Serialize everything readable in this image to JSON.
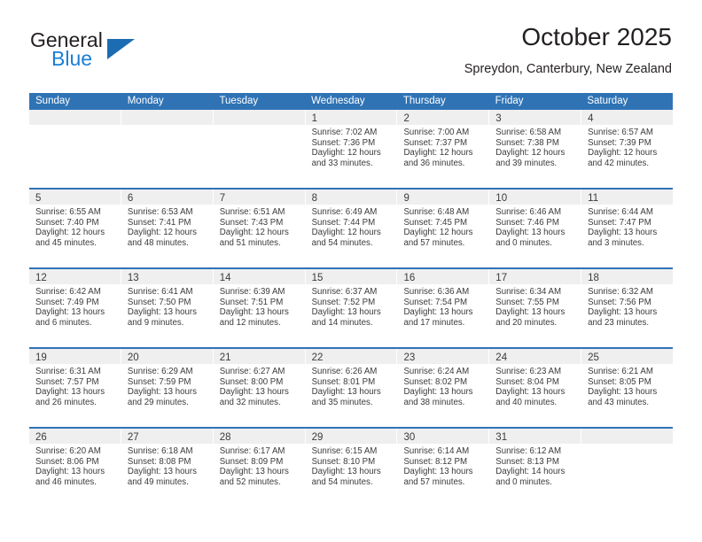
{
  "brand": {
    "name_part1": "General",
    "name_part2": "Blue"
  },
  "header": {
    "title": "October 2025",
    "location": "Spreydon, Canterbury, New Zealand"
  },
  "colors": {
    "header_blue": "#2f73b5",
    "brand_blue": "#1a7fd4",
    "day_band_gray": "#efeff0"
  },
  "weekdays": [
    "Sunday",
    "Monday",
    "Tuesday",
    "Wednesday",
    "Thursday",
    "Friday",
    "Saturday"
  ],
  "weeks": [
    [
      {
        "day": "",
        "sunrise": "",
        "sunset": "",
        "daylight1": "",
        "daylight2": ""
      },
      {
        "day": "",
        "sunrise": "",
        "sunset": "",
        "daylight1": "",
        "daylight2": ""
      },
      {
        "day": "",
        "sunrise": "",
        "sunset": "",
        "daylight1": "",
        "daylight2": ""
      },
      {
        "day": "1",
        "sunrise": "Sunrise: 7:02 AM",
        "sunset": "Sunset: 7:36 PM",
        "daylight1": "Daylight: 12 hours",
        "daylight2": "and 33 minutes."
      },
      {
        "day": "2",
        "sunrise": "Sunrise: 7:00 AM",
        "sunset": "Sunset: 7:37 PM",
        "daylight1": "Daylight: 12 hours",
        "daylight2": "and 36 minutes."
      },
      {
        "day": "3",
        "sunrise": "Sunrise: 6:58 AM",
        "sunset": "Sunset: 7:38 PM",
        "daylight1": "Daylight: 12 hours",
        "daylight2": "and 39 minutes."
      },
      {
        "day": "4",
        "sunrise": "Sunrise: 6:57 AM",
        "sunset": "Sunset: 7:39 PM",
        "daylight1": "Daylight: 12 hours",
        "daylight2": "and 42 minutes."
      }
    ],
    [
      {
        "day": "5",
        "sunrise": "Sunrise: 6:55 AM",
        "sunset": "Sunset: 7:40 PM",
        "daylight1": "Daylight: 12 hours",
        "daylight2": "and 45 minutes."
      },
      {
        "day": "6",
        "sunrise": "Sunrise: 6:53 AM",
        "sunset": "Sunset: 7:41 PM",
        "daylight1": "Daylight: 12 hours",
        "daylight2": "and 48 minutes."
      },
      {
        "day": "7",
        "sunrise": "Sunrise: 6:51 AM",
        "sunset": "Sunset: 7:43 PM",
        "daylight1": "Daylight: 12 hours",
        "daylight2": "and 51 minutes."
      },
      {
        "day": "8",
        "sunrise": "Sunrise: 6:49 AM",
        "sunset": "Sunset: 7:44 PM",
        "daylight1": "Daylight: 12 hours",
        "daylight2": "and 54 minutes."
      },
      {
        "day": "9",
        "sunrise": "Sunrise: 6:48 AM",
        "sunset": "Sunset: 7:45 PM",
        "daylight1": "Daylight: 12 hours",
        "daylight2": "and 57 minutes."
      },
      {
        "day": "10",
        "sunrise": "Sunrise: 6:46 AM",
        "sunset": "Sunset: 7:46 PM",
        "daylight1": "Daylight: 13 hours",
        "daylight2": "and 0 minutes."
      },
      {
        "day": "11",
        "sunrise": "Sunrise: 6:44 AM",
        "sunset": "Sunset: 7:47 PM",
        "daylight1": "Daylight: 13 hours",
        "daylight2": "and 3 minutes."
      }
    ],
    [
      {
        "day": "12",
        "sunrise": "Sunrise: 6:42 AM",
        "sunset": "Sunset: 7:49 PM",
        "daylight1": "Daylight: 13 hours",
        "daylight2": "and 6 minutes."
      },
      {
        "day": "13",
        "sunrise": "Sunrise: 6:41 AM",
        "sunset": "Sunset: 7:50 PM",
        "daylight1": "Daylight: 13 hours",
        "daylight2": "and 9 minutes."
      },
      {
        "day": "14",
        "sunrise": "Sunrise: 6:39 AM",
        "sunset": "Sunset: 7:51 PM",
        "daylight1": "Daylight: 13 hours",
        "daylight2": "and 12 minutes."
      },
      {
        "day": "15",
        "sunrise": "Sunrise: 6:37 AM",
        "sunset": "Sunset: 7:52 PM",
        "daylight1": "Daylight: 13 hours",
        "daylight2": "and 14 minutes."
      },
      {
        "day": "16",
        "sunrise": "Sunrise: 6:36 AM",
        "sunset": "Sunset: 7:54 PM",
        "daylight1": "Daylight: 13 hours",
        "daylight2": "and 17 minutes."
      },
      {
        "day": "17",
        "sunrise": "Sunrise: 6:34 AM",
        "sunset": "Sunset: 7:55 PM",
        "daylight1": "Daylight: 13 hours",
        "daylight2": "and 20 minutes."
      },
      {
        "day": "18",
        "sunrise": "Sunrise: 6:32 AM",
        "sunset": "Sunset: 7:56 PM",
        "daylight1": "Daylight: 13 hours",
        "daylight2": "and 23 minutes."
      }
    ],
    [
      {
        "day": "19",
        "sunrise": "Sunrise: 6:31 AM",
        "sunset": "Sunset: 7:57 PM",
        "daylight1": "Daylight: 13 hours",
        "daylight2": "and 26 minutes."
      },
      {
        "day": "20",
        "sunrise": "Sunrise: 6:29 AM",
        "sunset": "Sunset: 7:59 PM",
        "daylight1": "Daylight: 13 hours",
        "daylight2": "and 29 minutes."
      },
      {
        "day": "21",
        "sunrise": "Sunrise: 6:27 AM",
        "sunset": "Sunset: 8:00 PM",
        "daylight1": "Daylight: 13 hours",
        "daylight2": "and 32 minutes."
      },
      {
        "day": "22",
        "sunrise": "Sunrise: 6:26 AM",
        "sunset": "Sunset: 8:01 PM",
        "daylight1": "Daylight: 13 hours",
        "daylight2": "and 35 minutes."
      },
      {
        "day": "23",
        "sunrise": "Sunrise: 6:24 AM",
        "sunset": "Sunset: 8:02 PM",
        "daylight1": "Daylight: 13 hours",
        "daylight2": "and 38 minutes."
      },
      {
        "day": "24",
        "sunrise": "Sunrise: 6:23 AM",
        "sunset": "Sunset: 8:04 PM",
        "daylight1": "Daylight: 13 hours",
        "daylight2": "and 40 minutes."
      },
      {
        "day": "25",
        "sunrise": "Sunrise: 6:21 AM",
        "sunset": "Sunset: 8:05 PM",
        "daylight1": "Daylight: 13 hours",
        "daylight2": "and 43 minutes."
      }
    ],
    [
      {
        "day": "26",
        "sunrise": "Sunrise: 6:20 AM",
        "sunset": "Sunset: 8:06 PM",
        "daylight1": "Daylight: 13 hours",
        "daylight2": "and 46 minutes."
      },
      {
        "day": "27",
        "sunrise": "Sunrise: 6:18 AM",
        "sunset": "Sunset: 8:08 PM",
        "daylight1": "Daylight: 13 hours",
        "daylight2": "and 49 minutes."
      },
      {
        "day": "28",
        "sunrise": "Sunrise: 6:17 AM",
        "sunset": "Sunset: 8:09 PM",
        "daylight1": "Daylight: 13 hours",
        "daylight2": "and 52 minutes."
      },
      {
        "day": "29",
        "sunrise": "Sunrise: 6:15 AM",
        "sunset": "Sunset: 8:10 PM",
        "daylight1": "Daylight: 13 hours",
        "daylight2": "and 54 minutes."
      },
      {
        "day": "30",
        "sunrise": "Sunrise: 6:14 AM",
        "sunset": "Sunset: 8:12 PM",
        "daylight1": "Daylight: 13 hours",
        "daylight2": "and 57 minutes."
      },
      {
        "day": "31",
        "sunrise": "Sunrise: 6:12 AM",
        "sunset": "Sunset: 8:13 PM",
        "daylight1": "Daylight: 14 hours",
        "daylight2": "and 0 minutes."
      },
      {
        "day": "",
        "sunrise": "",
        "sunset": "",
        "daylight1": "",
        "daylight2": ""
      }
    ]
  ]
}
